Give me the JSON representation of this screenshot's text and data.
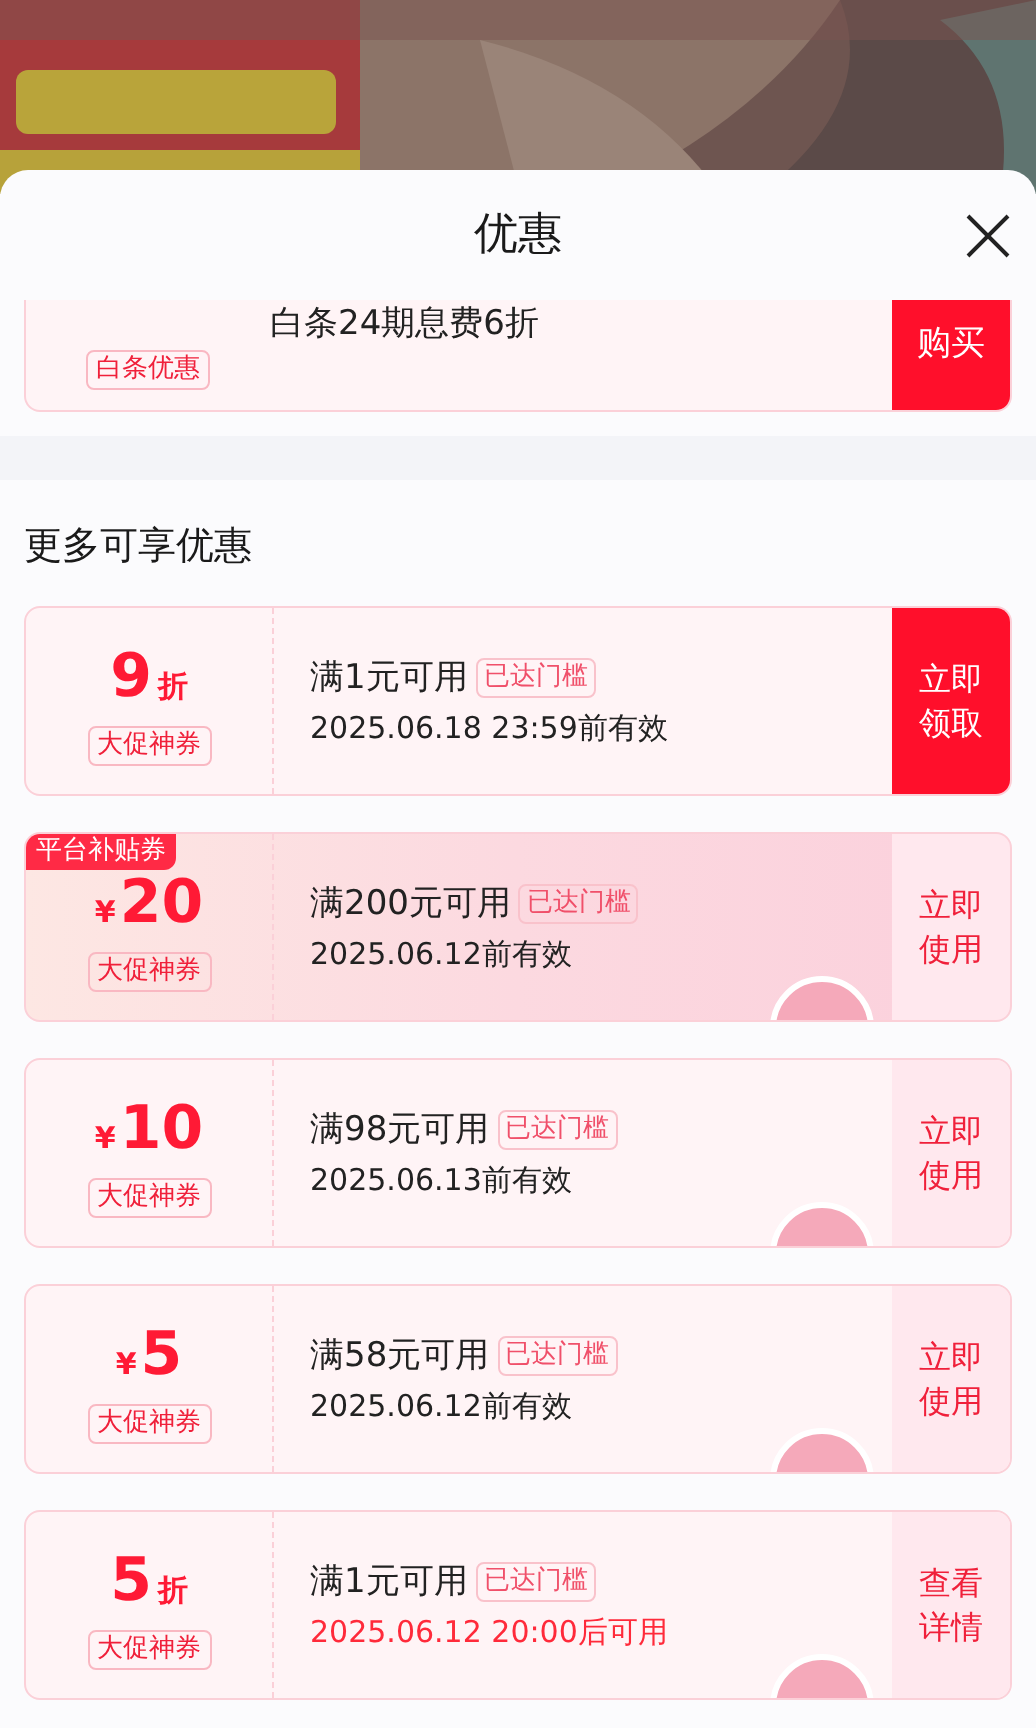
{
  "sheet": {
    "title": "优惠"
  },
  "top_offer": {
    "tag": "白条优惠",
    "text": "白条24期息费6折",
    "button": "购买"
  },
  "section_title": "更多可享优惠",
  "coupons": [
    {
      "amount": "9",
      "unit": "折",
      "unit_before": false,
      "tag": "大促神券",
      "condition": "满1元可用",
      "badge": "已达门槛",
      "validity": "2025.06.18 23:59前有效",
      "upcoming": false,
      "button": "立即领取",
      "primary_button": true,
      "claimed": false,
      "featured": false
    },
    {
      "corner_label": "平台补贴券",
      "amount": "20",
      "unit": "¥",
      "unit_before": true,
      "tag": "大促神券",
      "condition": "满200元可用",
      "badge": "已达门槛",
      "validity": "2025.06.12前有效",
      "upcoming": false,
      "button": "立即使用",
      "primary_button": false,
      "claimed": true,
      "featured": true
    },
    {
      "amount": "10",
      "unit": "¥",
      "unit_before": true,
      "tag": "大促神券",
      "condition": "满98元可用",
      "badge": "已达门槛",
      "validity": "2025.06.13前有效",
      "upcoming": false,
      "button": "立即使用",
      "primary_button": false,
      "claimed": true,
      "featured": false
    },
    {
      "amount": "5",
      "unit": "¥",
      "unit_before": true,
      "tag": "大促神券",
      "condition": "满58元可用",
      "badge": "已达门槛",
      "validity": "2025.06.12前有效",
      "upcoming": false,
      "button": "立即使用",
      "primary_button": false,
      "claimed": true,
      "featured": false
    },
    {
      "amount": "5",
      "unit": "折",
      "unit_before": false,
      "tag": "大促神券",
      "condition": "满1元可用",
      "badge": "已达门槛",
      "validity": "2025.06.12 20:00后可用",
      "upcoming": true,
      "button": "查看详情",
      "primary_button": false,
      "claimed": true,
      "featured": false
    }
  ]
}
